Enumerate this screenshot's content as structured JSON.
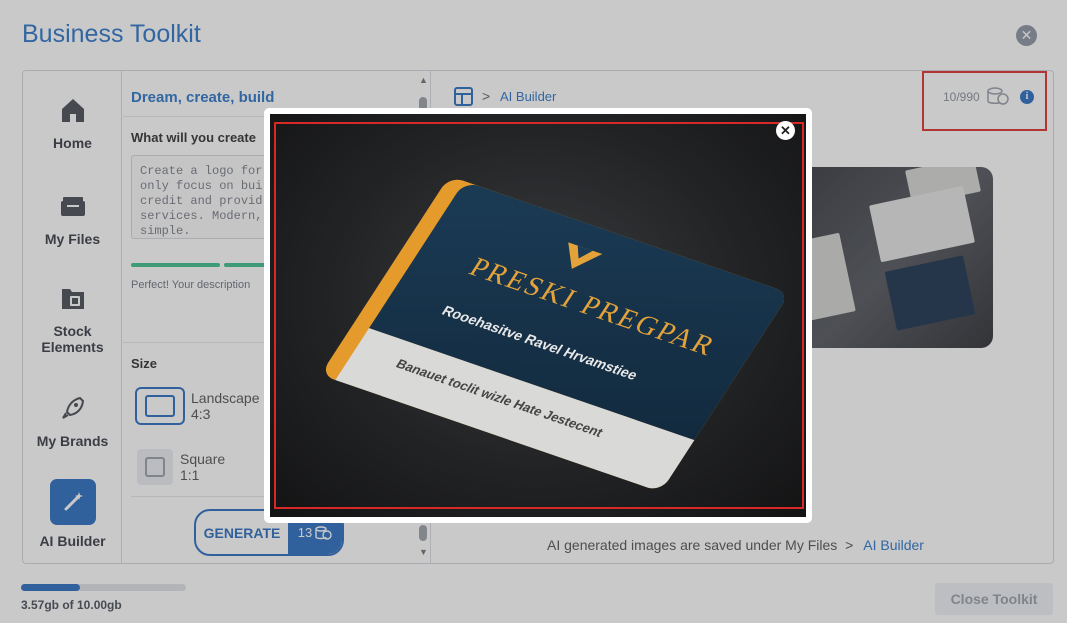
{
  "app": {
    "title": "Business Toolkit",
    "close_glyph": "✕"
  },
  "sidebar": {
    "items": [
      {
        "label": "Home",
        "icon": "home-icon"
      },
      {
        "label": "My Files",
        "icon": "folder-icon"
      },
      {
        "label": "Stock Elements",
        "icon": "stock-folder-icon"
      },
      {
        "label": "My Brands",
        "icon": "rocket-icon"
      },
      {
        "label": "AI Builder",
        "icon": "magic-wand-icon",
        "active": true
      }
    ]
  },
  "form": {
    "heading": "Dream, create, build",
    "question": "What will you create",
    "prompt_text": "Create a logo for\nonly focus on bui\ncredit and provid\nservices. Modern,\nsimple.",
    "hint": "Perfect! Your description",
    "size_label": "Size",
    "options": [
      {
        "label": "Landscape",
        "ratio": "4:3",
        "selected": true
      },
      {
        "label": "Square",
        "ratio": "1:1",
        "selected": false
      }
    ],
    "generate_label": "GENERATE",
    "generate_cost": "13"
  },
  "main": {
    "breadcrumb": "AI Builder",
    "breadcrumb_sep": ">",
    "credits": "10/990",
    "info_glyph": "i",
    "footnote": "AI generated images are saved under My Files",
    "footnote_sep": ">",
    "footnote_link": "AI Builder"
  },
  "storage": {
    "text": "3.57gb of 10.00gb",
    "used_fraction": 0.357
  },
  "close_toolkit_label": "Close Toolkit",
  "modal": {
    "close_glyph": "✕",
    "card_name": "PRESKI PREGPAR",
    "card_line1": "Rooehasitve Ravel Hrvamstiee",
    "card_line2": "Banauet toclit wizle Hate Jestecent"
  },
  "colors": {
    "accent": "#2d6fbf",
    "highlight": "#e0322e",
    "progress_green": "#3dbf8e",
    "card_orange": "#e49b2c",
    "card_navy": "#1b3b55"
  }
}
